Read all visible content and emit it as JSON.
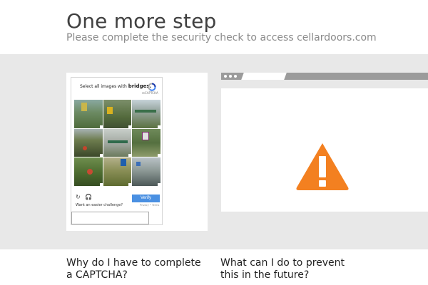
{
  "header": {
    "title": "One more step",
    "subtitle": "Please complete the security check to access cellardoors.com"
  },
  "captcha": {
    "challenge_prefix": "Select all images with",
    "challenge_target": "bridges.",
    "recaptcha_label": "reCAPTCHA",
    "verify_label": "Verify",
    "easier_label": "Want an easier challenge?",
    "privacy_label": "Privacy • Terms",
    "refresh_glyph": "↻",
    "audio_glyph": "🎧",
    "input_value": ""
  },
  "illustration": {
    "alert_icon": "warning-triangle-icon",
    "alert_color": "#f38020"
  },
  "faq": {
    "q1": "Why do I have to complete a CAPTCHA?",
    "q2": "What can I do to prevent this in the future?"
  },
  "colors": {
    "band": "#e8e8e8",
    "accent": "#4a90e2"
  }
}
